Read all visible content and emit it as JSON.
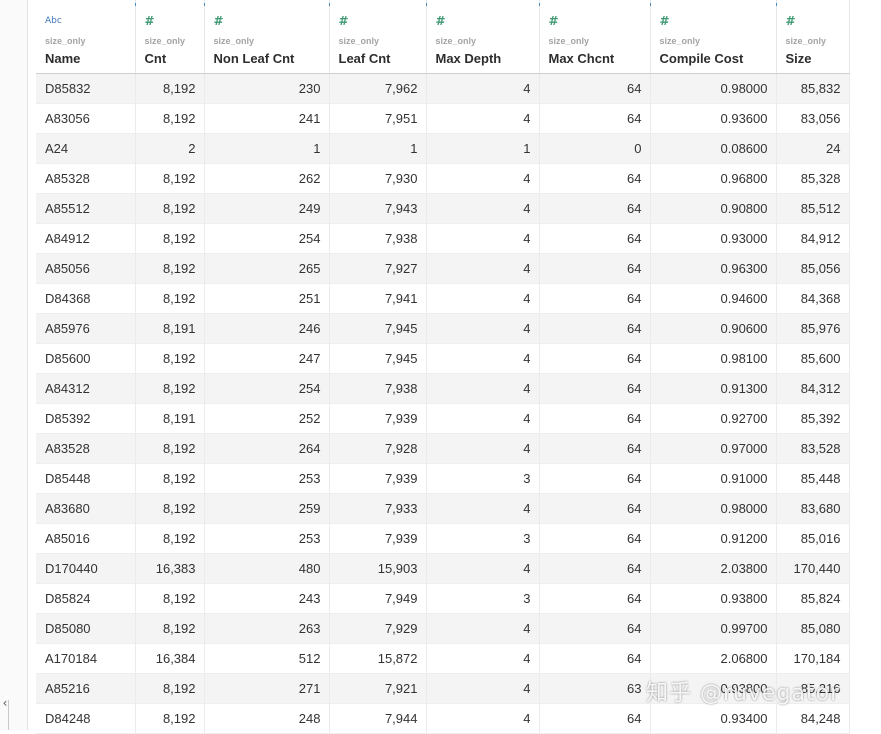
{
  "columns": [
    {
      "type": "Abc",
      "sub": "size_only",
      "name": "Name"
    },
    {
      "type": "#",
      "sub": "size_only",
      "name": "Cnt"
    },
    {
      "type": "#",
      "sub": "size_only",
      "name": "Non Leaf Cnt"
    },
    {
      "type": "#",
      "sub": "size_only",
      "name": "Leaf Cnt"
    },
    {
      "type": "#",
      "sub": "size_only",
      "name": "Max Depth"
    },
    {
      "type": "#",
      "sub": "size_only",
      "name": "Max Chcnt"
    },
    {
      "type": "#",
      "sub": "size_only",
      "name": "Compile Cost"
    },
    {
      "type": "#",
      "sub": "size_only",
      "name": "Size"
    }
  ],
  "rows": [
    [
      "D85832",
      "8,192",
      "230",
      "7,962",
      "4",
      "64",
      "0.98000",
      "85,832"
    ],
    [
      "A83056",
      "8,192",
      "241",
      "7,951",
      "4",
      "64",
      "0.93600",
      "83,056"
    ],
    [
      "A24",
      "2",
      "1",
      "1",
      "1",
      "0",
      "0.08600",
      "24"
    ],
    [
      "A85328",
      "8,192",
      "262",
      "7,930",
      "4",
      "64",
      "0.96800",
      "85,328"
    ],
    [
      "A85512",
      "8,192",
      "249",
      "7,943",
      "4",
      "64",
      "0.90800",
      "85,512"
    ],
    [
      "A84912",
      "8,192",
      "254",
      "7,938",
      "4",
      "64",
      "0.93000",
      "84,912"
    ],
    [
      "A85056",
      "8,192",
      "265",
      "7,927",
      "4",
      "64",
      "0.96300",
      "85,056"
    ],
    [
      "D84368",
      "8,192",
      "251",
      "7,941",
      "4",
      "64",
      "0.94600",
      "84,368"
    ],
    [
      "A85976",
      "8,191",
      "246",
      "7,945",
      "4",
      "64",
      "0.90600",
      "85,976"
    ],
    [
      "D85600",
      "8,192",
      "247",
      "7,945",
      "4",
      "64",
      "0.98100",
      "85,600"
    ],
    [
      "A84312",
      "8,192",
      "254",
      "7,938",
      "4",
      "64",
      "0.91300",
      "84,312"
    ],
    [
      "D85392",
      "8,191",
      "252",
      "7,939",
      "4",
      "64",
      "0.92700",
      "85,392"
    ],
    [
      "A83528",
      "8,192",
      "264",
      "7,928",
      "4",
      "64",
      "0.97000",
      "83,528"
    ],
    [
      "D85448",
      "8,192",
      "253",
      "7,939",
      "3",
      "64",
      "0.91000",
      "85,448"
    ],
    [
      "A83680",
      "8,192",
      "259",
      "7,933",
      "4",
      "64",
      "0.98000",
      "83,680"
    ],
    [
      "A85016",
      "8,192",
      "253",
      "7,939",
      "3",
      "64",
      "0.91200",
      "85,016"
    ],
    [
      "D170440",
      "16,383",
      "480",
      "15,903",
      "4",
      "64",
      "2.03800",
      "170,440"
    ],
    [
      "D85824",
      "8,192",
      "243",
      "7,949",
      "3",
      "64",
      "0.93800",
      "85,824"
    ],
    [
      "D85080",
      "8,192",
      "263",
      "7,929",
      "4",
      "64",
      "0.99700",
      "85,080"
    ],
    [
      "A170184",
      "16,384",
      "512",
      "15,872",
      "4",
      "64",
      "2.06800",
      "170,184"
    ],
    [
      "A85216",
      "8,192",
      "271",
      "7,921",
      "4",
      "63",
      "0.93800",
      "85,216"
    ],
    [
      "D84248",
      "8,192",
      "248",
      "7,944",
      "4",
      "64",
      "0.93400",
      "84,248"
    ]
  ],
  "watermark": "知乎 @ruvegator",
  "gutter_arrow": "‹",
  "colors": {
    "accent": "#4a8ec7",
    "numeric_icon": "#3f9a72",
    "text_icon": "#3f78b5",
    "row_stripe": "#f4f4f4"
  }
}
